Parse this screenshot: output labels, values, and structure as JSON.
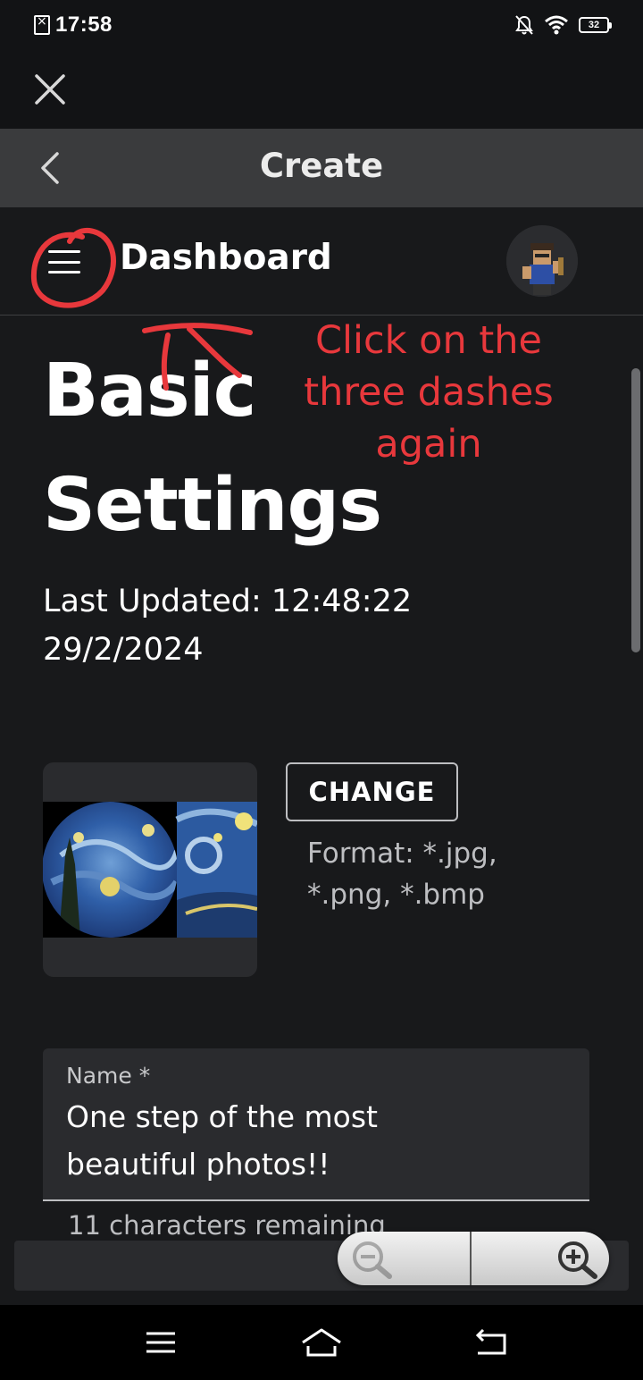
{
  "status_bar": {
    "time": "17:58",
    "battery": "32",
    "icons": [
      "sim-off-icon",
      "notifications-off-icon",
      "wifi-icon",
      "battery-icon"
    ]
  },
  "header": {
    "title": "Create"
  },
  "topnav": {
    "title": "Dashboard"
  },
  "page": {
    "title_line1": "Basic",
    "title_line2": "Settings",
    "updated_line1": "Last Updated: 12:48:22",
    "updated_line2": "29/2/2024",
    "change_label": "CHANGE",
    "format_line1": "Format: *.jpg,",
    "format_line2": "*.png, *.bmp",
    "name_label": "Name *",
    "name_line1": "One step of the most",
    "name_line2": "beautiful photos!!",
    "helper_text": "11 characters remaining"
  },
  "annotation": {
    "line1": "Click on the",
    "line2": "three dashes",
    "line3": "again",
    "color": "#e8383c"
  },
  "zoom": {
    "out_icon": "zoom-out-icon",
    "in_icon": "zoom-in-icon"
  },
  "navbar": {
    "icons": [
      "menu-icon",
      "home-icon",
      "back-icon"
    ]
  }
}
